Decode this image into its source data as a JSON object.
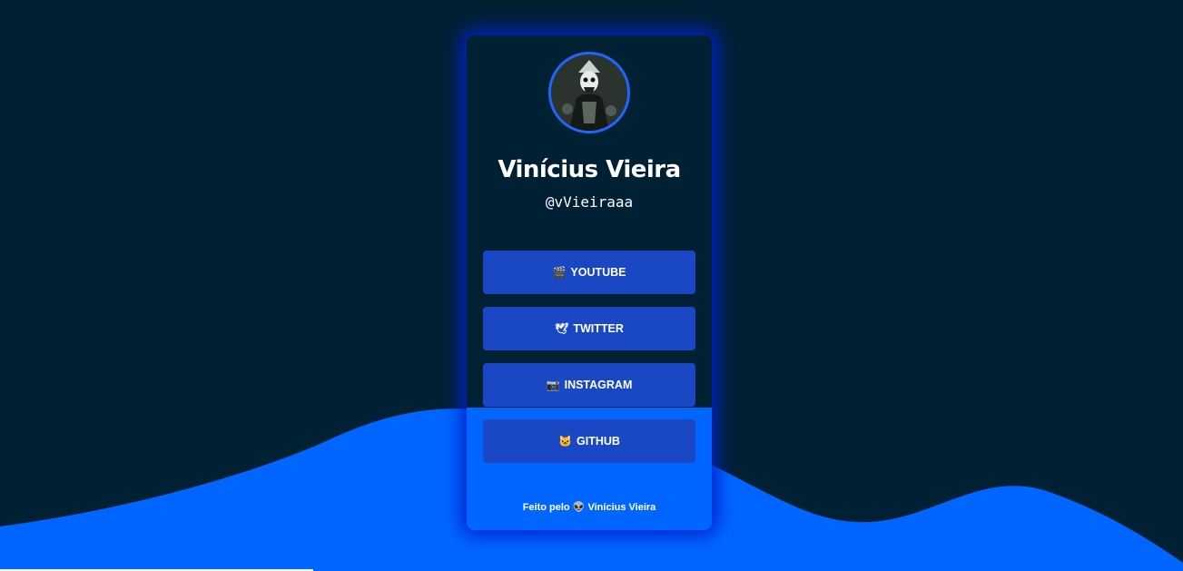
{
  "profile": {
    "name": "Vinícius Vieira",
    "handle": "@vVieiraaa"
  },
  "links": [
    {
      "icon": "🎬",
      "icon_name": "clapperboard-icon",
      "label": "YOUTUBE"
    },
    {
      "icon": "🕊",
      "icon_name": "dove-icon",
      "label": "TWITTER"
    },
    {
      "icon": "📷",
      "icon_name": "camera-icon",
      "label": "INSTAGRAM"
    },
    {
      "icon": "🐱",
      "icon_name": "cat-icon",
      "label": "GITHUB"
    }
  ],
  "footer": {
    "prefix": "Feito pelo",
    "icon": "👽",
    "author": "Vinícius Vieira"
  },
  "colors": {
    "background": "#002033",
    "wave": "#0066ff",
    "button": "#1a47c4",
    "glow": "#0022cc"
  }
}
